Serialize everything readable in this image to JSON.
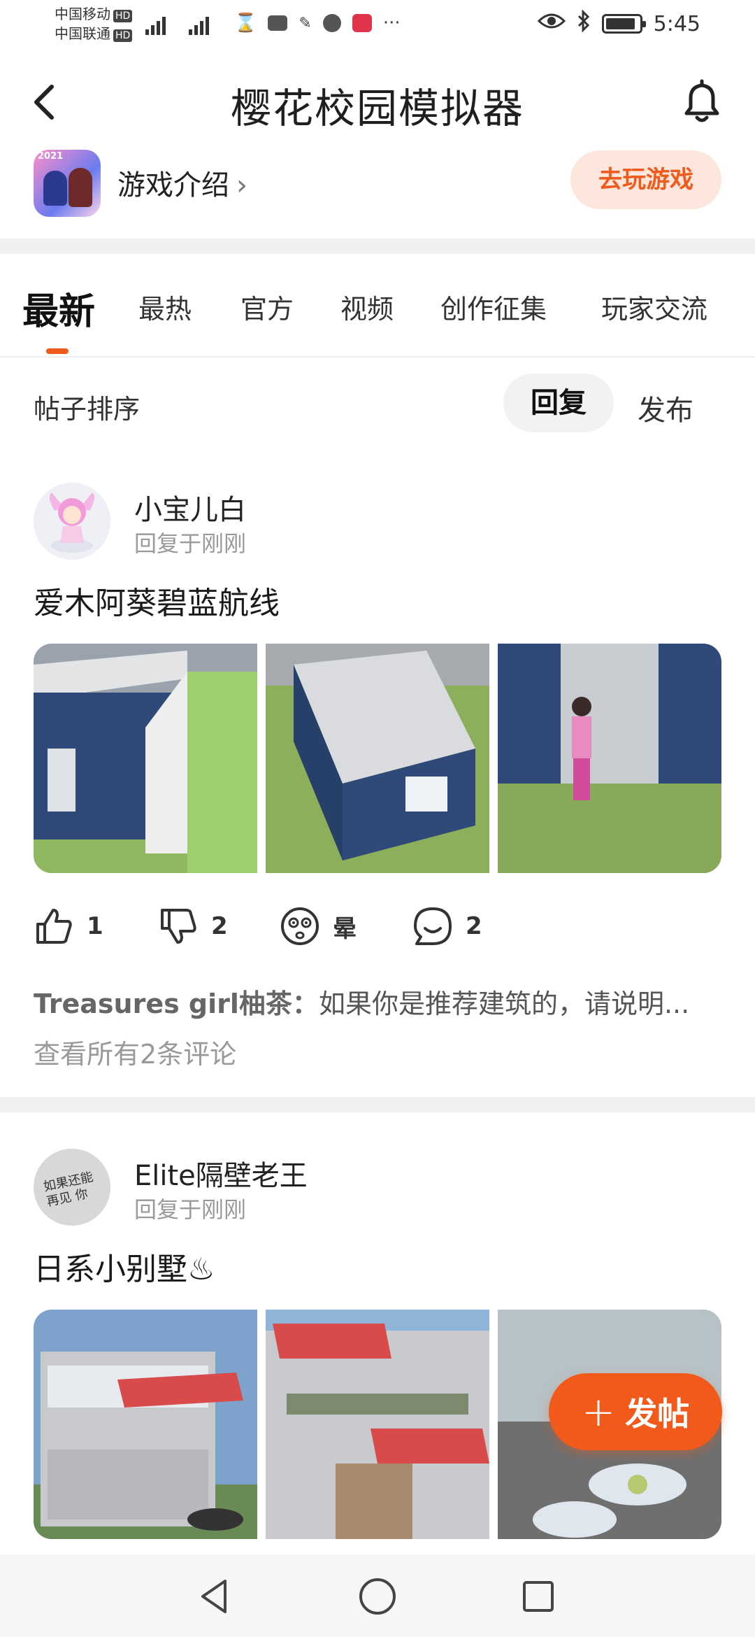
{
  "status_bar": {
    "carrier1": "中国移动",
    "carrier2": "中国联通",
    "hd": "HD",
    "network": "4G",
    "time": "5:45",
    "more": "···"
  },
  "header": {
    "title": "樱花校园模拟器",
    "game_intro": "游戏介绍",
    "game_icon_badge": "2021",
    "play_button": "去玩游戏"
  },
  "tabs": [
    {
      "label": "最新",
      "active": true
    },
    {
      "label": "最热",
      "active": false
    },
    {
      "label": "官方",
      "active": false
    },
    {
      "label": "视频",
      "active": false
    },
    {
      "label": "创作征集",
      "active": false
    },
    {
      "label": "玩家交流",
      "active": false
    }
  ],
  "sort": {
    "label": "帖子排序",
    "options": [
      "回复",
      "发布"
    ],
    "selected": "回复"
  },
  "posts": [
    {
      "author": "小宝儿白",
      "time": "回复于刚刚",
      "title": "爱木阿葵碧蓝航线",
      "likes": "1",
      "dislikes": "2",
      "reaction": "晕",
      "comments": "2",
      "top_comment_author": "Treasures girl柚茶：",
      "top_comment_text": "如果你是推荐建筑的，请说明...",
      "view_all": "查看所有2条评论"
    },
    {
      "author": "Elite隔壁老王",
      "time": "回复于刚刚",
      "title": "日系小别墅♨",
      "avatar_text": "如果还能再见 你"
    }
  ],
  "fab": {
    "label": "发帖",
    "icon": "plus-icon"
  },
  "colors": {
    "accent": "#f25a1c",
    "accent_light": "#fde7dc",
    "divider": "#efefef"
  }
}
